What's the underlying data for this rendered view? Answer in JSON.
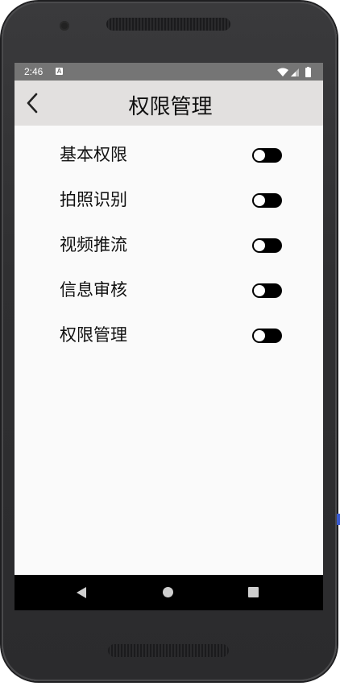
{
  "status_bar": {
    "time": "2:46",
    "notification_icon": "A",
    "icons": [
      "wifi-icon",
      "signal-icon",
      "battery-icon"
    ]
  },
  "app_bar": {
    "back_icon": "chevron-left-icon",
    "title": "权限管理"
  },
  "permissions": [
    {
      "label": "基本权限",
      "enabled": false
    },
    {
      "label": "拍照识别",
      "enabled": false
    },
    {
      "label": "视频推流",
      "enabled": false
    },
    {
      "label": "信息审核",
      "enabled": false
    },
    {
      "label": "权限管理",
      "enabled": false
    }
  ],
  "nav_bar": {
    "icons": [
      "nav-back-icon",
      "nav-home-icon",
      "nav-recents-icon"
    ]
  },
  "colors": {
    "status_bar": "#757575",
    "app_bar": "#e2e0df",
    "screen_bg": "#fafafa",
    "toggle_track": "#000000",
    "toggle_knob": "#ffffff"
  }
}
